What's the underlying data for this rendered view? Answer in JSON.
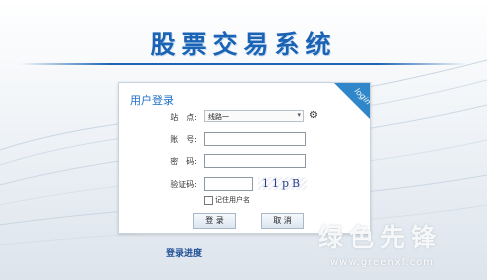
{
  "app": {
    "title": "股票交易系统"
  },
  "login": {
    "panel_title": "用户登录",
    "corner_tag": "login",
    "site_label": "站　点:",
    "site_value": "线路一",
    "account_label": "账　号:",
    "account_value": "",
    "password_label": "密　码:",
    "password_value": "",
    "captcha_label": "验证码:",
    "captcha_value": "",
    "captcha_text": "11pB",
    "remember_label": "记住用户名",
    "remember_checked": false,
    "login_button": "登 录",
    "cancel_button": "取 消"
  },
  "footer": {
    "progress_link": "登录进度"
  },
  "watermark": {
    "text": "绿色先锋",
    "url": "www.greenxf.com"
  },
  "colors": {
    "title": "#1b63b5",
    "accent": "#2f86c9",
    "panel_title": "#1f6fc5"
  }
}
